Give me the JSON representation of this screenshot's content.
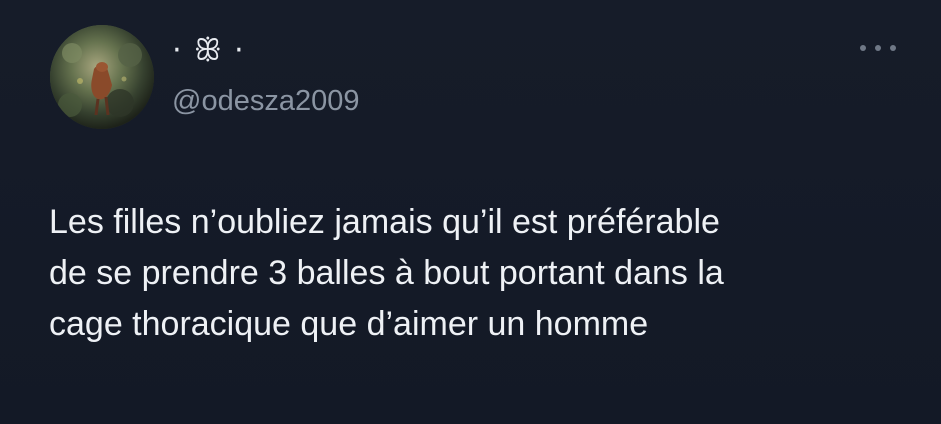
{
  "tweet": {
    "display_name": "⋅ ꕥ ⋅",
    "handle": "@odesza2009",
    "text": "Les filles n’oubliez jamais qu’il est préférable\nde se prendre 3 balles à bout portant dans la\ncage thoracique que d’aimer un homme",
    "more_icon": "more-horizontal-icon",
    "avatar_icon": "avatar-photo"
  },
  "colors": {
    "background": "#141a26",
    "text": "#eef1f5",
    "secondary_text": "#8b95a3"
  }
}
